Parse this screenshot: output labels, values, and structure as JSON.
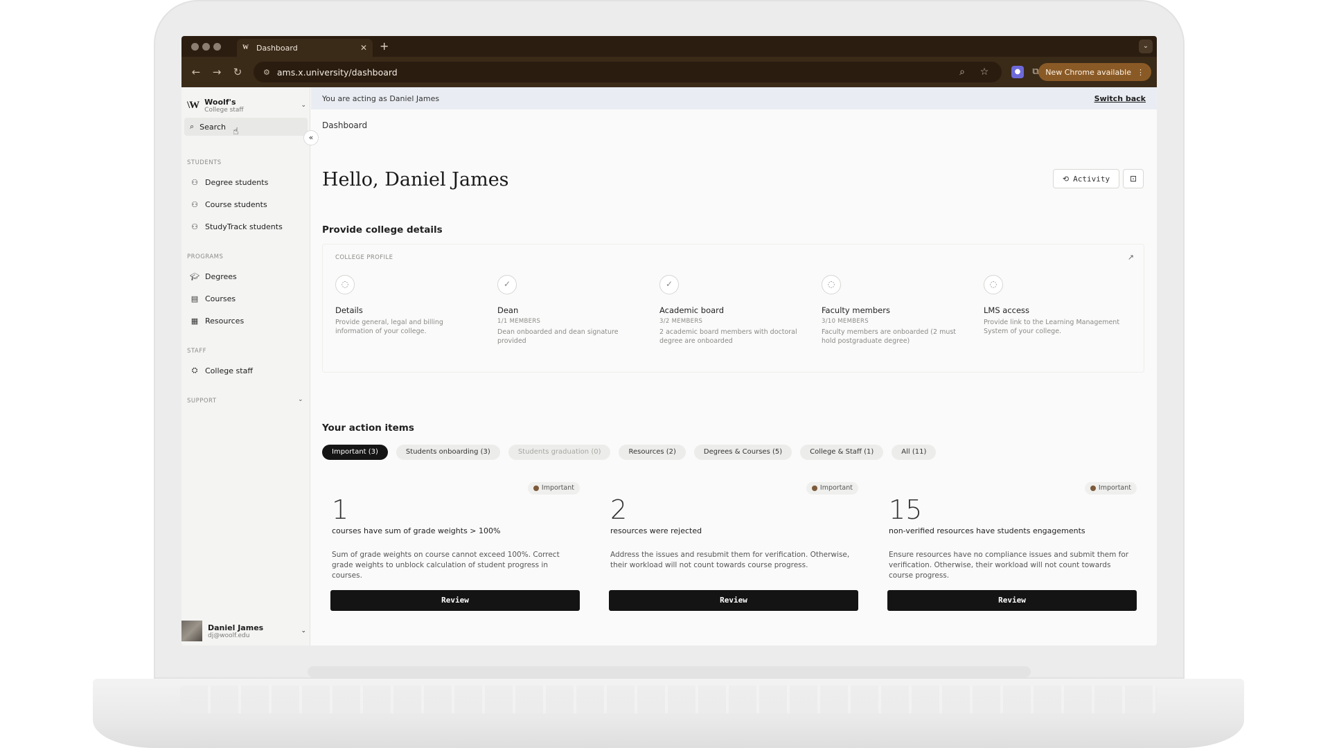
{
  "browser": {
    "tab_title": "Dashboard",
    "tab_favicon": "W",
    "url": "ams.x.university/dashboard",
    "update_label": "New Chrome available"
  },
  "banner": {
    "acting_text": "You are acting as Daniel James",
    "switch_label": "Switch back"
  },
  "sidebar": {
    "org_logo": "\\W",
    "org_name": "Woolf's",
    "org_role": "College staff",
    "search_label": "Search",
    "sections": {
      "students": "STUDENTS",
      "programs": "PROGRAMS",
      "staff": "STAFF",
      "support": "SUPPORT"
    },
    "items": {
      "degree_students": "Degree students",
      "course_students": "Course students",
      "studytrack_students": "StudyTrack students",
      "degrees": "Degrees",
      "courses": "Courses",
      "resources": "Resources",
      "college_staff": "College staff"
    },
    "user": {
      "name": "Daniel James",
      "email": "dj@woolf.edu"
    }
  },
  "main": {
    "breadcrumb": "Dashboard",
    "greeting": "Hello, Daniel James",
    "activity_label": "Activity",
    "provide_heading": "Provide college details",
    "profile": {
      "label": "COLLEGE PROFILE",
      "steps": [
        {
          "title": "Details",
          "count": "",
          "desc": "Provide general, legal and billing information of your college.",
          "status": "pending"
        },
        {
          "title": "Dean",
          "count": "1/1 MEMBERS",
          "desc": "Dean onboarded and dean signature provided",
          "status": "done"
        },
        {
          "title": "Academic board",
          "count": "3/2 MEMBERS",
          "desc": "2 academic board members with doctoral degree are onboarded",
          "status": "done"
        },
        {
          "title": "Faculty members",
          "count": "3/10 MEMBERS",
          "desc": "Faculty members are onboarded (2 must hold postgraduate degree)",
          "status": "pending"
        },
        {
          "title": "LMS access",
          "count": "",
          "desc": "Provide link to the Learning Management System of your college.",
          "status": "pending"
        }
      ]
    },
    "actions_heading": "Your action items",
    "filters": [
      {
        "label": "Important (3)",
        "state": "active"
      },
      {
        "label": "Students onboarding (3)",
        "state": "normal"
      },
      {
        "label": "Students graduation (0)",
        "state": "disabled"
      },
      {
        "label": "Resources (2)",
        "state": "normal"
      },
      {
        "label": "Degrees & Courses (5)",
        "state": "normal"
      },
      {
        "label": "College & Staff (1)",
        "state": "normal"
      },
      {
        "label": "All (11)",
        "state": "normal"
      }
    ],
    "cards": [
      {
        "badge": "Important",
        "number": "1",
        "title": "courses have sum of grade weights > 100%",
        "desc": "Sum of grade weights on course cannot exceed 100%. Correct grade weights to unblock calculation of student progress in courses.",
        "button": "Review"
      },
      {
        "badge": "Important",
        "number": "2",
        "title": "resources were rejected",
        "desc": "Address the issues and resubmit them for verification. Otherwise, their workload will not count towards course progress.",
        "button": "Review"
      },
      {
        "badge": "Important",
        "number": "15",
        "title": "non-verified resources have students engagements",
        "desc": "Ensure resources have no compliance issues and submit them for verification. Otherwise, their workload will not count towards course progress.",
        "button": "Review"
      }
    ]
  },
  "colors": {
    "chrome_tabbar": "#2b1d10",
    "chrome_toolbar": "#3a2a18",
    "update_button": "#8a5a26",
    "banner_bg": "#e9edf3",
    "primary_dark": "#141414",
    "badge_dot": "#7d5a3a"
  }
}
